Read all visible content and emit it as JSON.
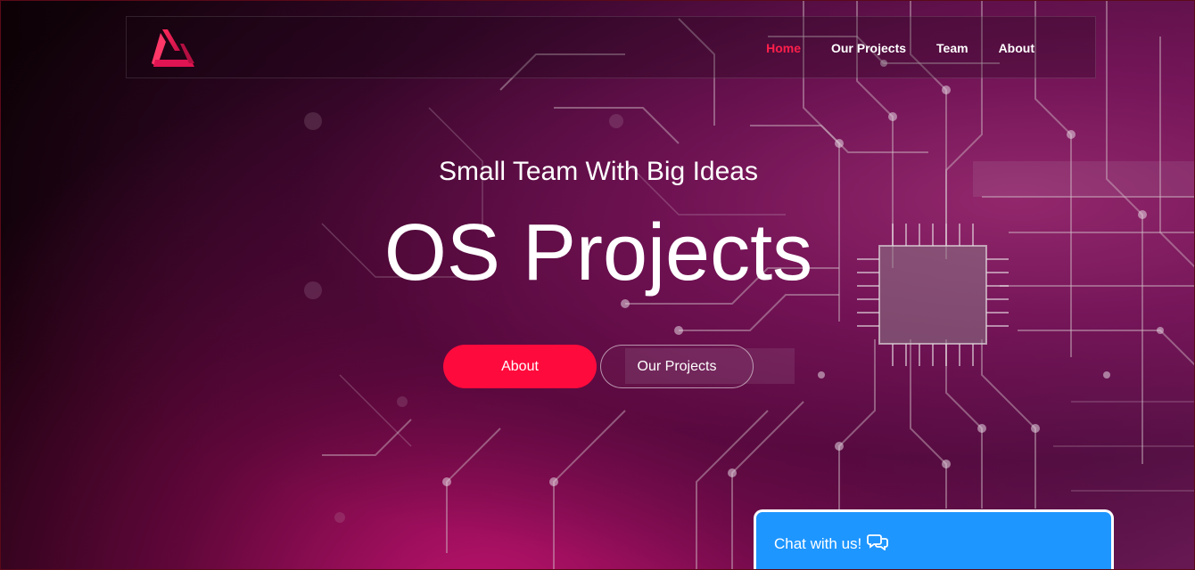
{
  "nav": {
    "logo_icon": "triangle-logo-icon",
    "items": [
      {
        "label": "Home",
        "active": true
      },
      {
        "label": "Our Projects",
        "active": false
      },
      {
        "label": "Team",
        "active": false
      },
      {
        "label": "About",
        "active": false
      }
    ]
  },
  "hero": {
    "subtitle": "Small Team With Big Ideas",
    "title": "OS Projects",
    "primary_button": "About",
    "secondary_button": "Our Projects"
  },
  "chat": {
    "label": "Chat with us!",
    "icon": "chat-bubbles-icon"
  },
  "colors": {
    "accent": "#ff0a3c",
    "nav_active": "#ff1f4b",
    "chat_bg": "#1e96ff"
  }
}
